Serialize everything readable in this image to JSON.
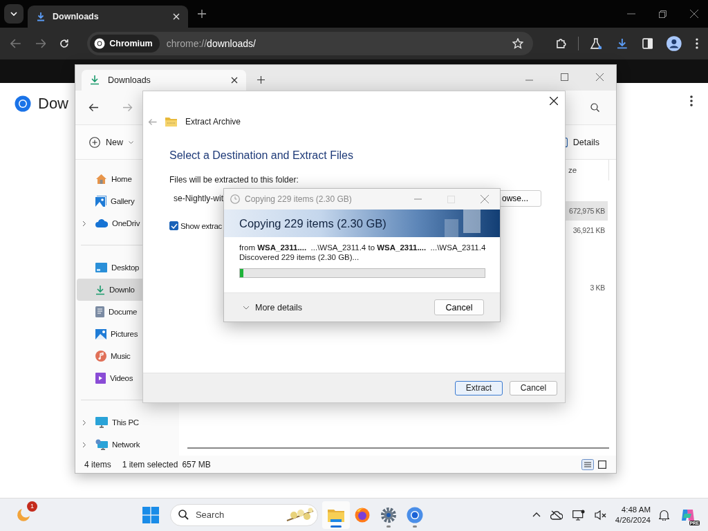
{
  "browser": {
    "tab": {
      "title": "Downloads",
      "selected": true
    },
    "site_chip": "Chromium",
    "url_scheme": "chrome://",
    "url_path": "downloads/",
    "page_heading": "Dow"
  },
  "explorer": {
    "tab": {
      "title": "Downloads",
      "selected": true
    },
    "command_bar": {
      "new_label": "New",
      "details_label": "Details"
    },
    "sidebar": [
      {
        "items": [
          {
            "label": "Home",
            "kind": "home",
            "expandable": false,
            "selected": false
          },
          {
            "label": "Gallery",
            "kind": "gallery",
            "expandable": false,
            "selected": false
          },
          {
            "label": "OneDriv",
            "kind": "cloud",
            "expandable": true,
            "selected": false
          }
        ]
      },
      {
        "items": [
          {
            "label": "Desktop",
            "kind": "desktop",
            "expandable": false,
            "selected": false
          },
          {
            "label": "Downlo",
            "kind": "download",
            "expandable": false,
            "selected": true
          },
          {
            "label": "Docume",
            "kind": "document",
            "expandable": false,
            "selected": false
          },
          {
            "label": "Pictures",
            "kind": "pictures",
            "expandable": false,
            "selected": false
          },
          {
            "label": "Music",
            "kind": "music",
            "expandable": false,
            "selected": false
          },
          {
            "label": "Videos",
            "kind": "videos",
            "expandable": false,
            "selected": false
          }
        ]
      },
      {
        "items": [
          {
            "label": "This PC",
            "kind": "pc",
            "expandable": true,
            "selected": false
          },
          {
            "label": "Network",
            "kind": "network",
            "expandable": true,
            "selected": false
          }
        ]
      }
    ],
    "column_header": "ze",
    "rows": [
      {
        "size": "672,975 KB",
        "selected": true
      },
      {
        "size": "36,921 KB",
        "selected": false
      },
      {
        "size": "3 KB",
        "selected": false
      }
    ],
    "status_bar": {
      "item_count": "4 items",
      "selection": "1 item selected",
      "selection_size": "657 MB"
    }
  },
  "extract_dialog": {
    "title": "Extract Archive",
    "heading": "Select a Destination and Extract Files",
    "folder_label": "Files will be extracted to this folder:",
    "folder_value": "se-Nightly-wit",
    "browse_button": "owse...",
    "show_files": {
      "label": "Show extrac",
      "checked": true
    },
    "buttons": [
      {
        "label": "Extract",
        "default": true
      },
      {
        "label": "Cancel",
        "default": false
      }
    ]
  },
  "copy_dialog": {
    "title": "Copying 229 items (2.30 GB)",
    "banner": "Copying 229 items (2.30 GB)",
    "from_line": "from **WSA_2311....**  ...\\WSA_2311.4 to **WSA_2311....**  ...\\WSA_2311.4",
    "status": "Discovered 229 items (2.30 GB)...",
    "level": 0.015,
    "more_details": "More details",
    "cancel": "Cancel"
  },
  "taskbar": {
    "notification_badge": "1",
    "search_placeholder": "Search",
    "time": "4:48 AM",
    "date": "4/26/2024",
    "copilot_badge": "PRE",
    "apps": [
      {
        "kind": "files",
        "running": true,
        "selected": true
      },
      {
        "kind": "firefox",
        "running": false,
        "selected": false
      },
      {
        "kind": "settings",
        "running": true,
        "selected": false
      },
      {
        "kind": "chromium",
        "running": true,
        "selected": false
      }
    ]
  }
}
